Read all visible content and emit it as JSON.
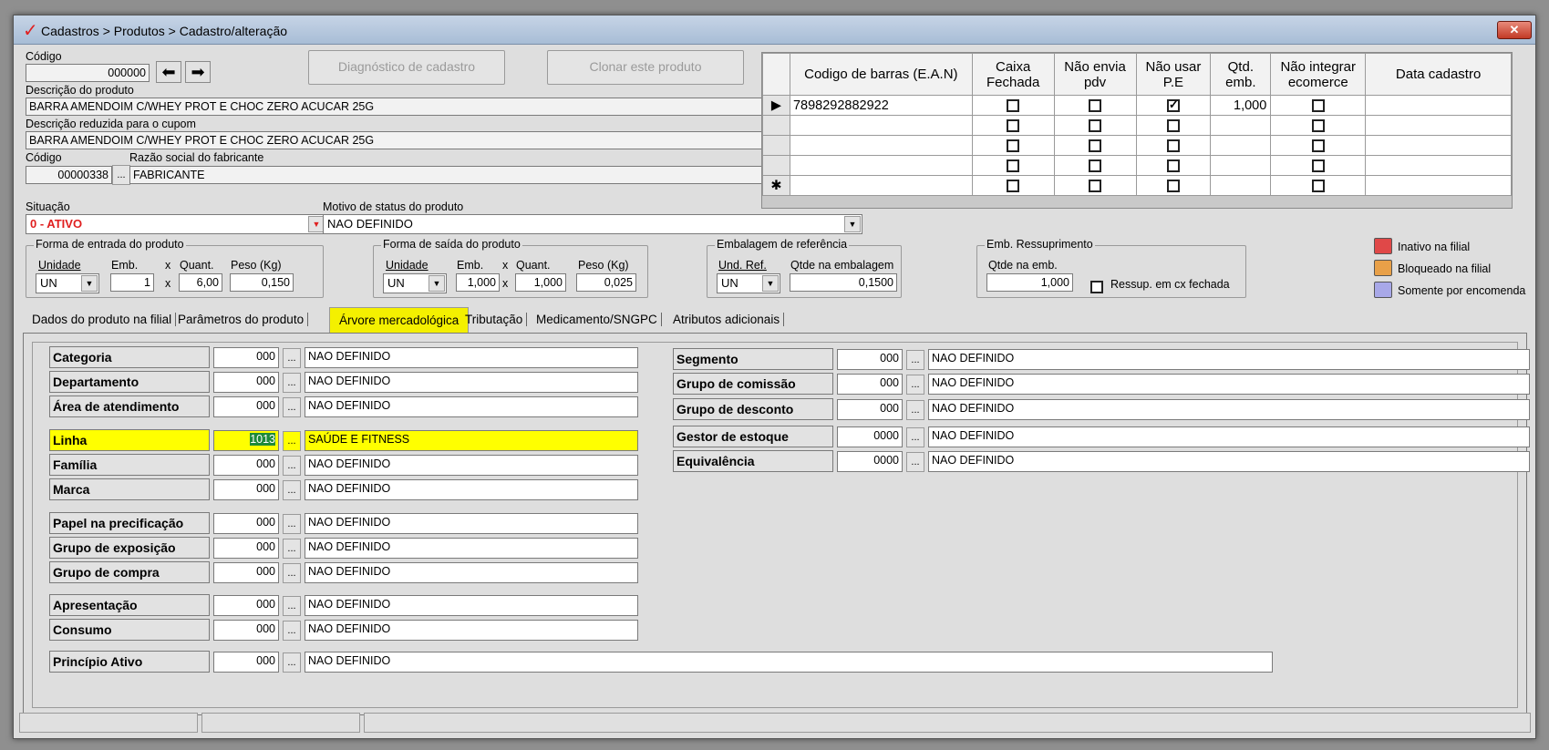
{
  "window": {
    "title": "Cadastros > Produtos > Cadastro/alteração",
    "close_label": "✕"
  },
  "header": {
    "codigo_label": "Código",
    "codigo_value": "000000",
    "diagnostico_label": "Diagnóstico de cadastro",
    "clonar_label": "Clonar este produto",
    "descricao_label": "Descrição  do produto",
    "descricao_value": "BARRA AMENDOIM C/WHEY PROT E CHOC ZERO ACUCAR 25G",
    "descricao_reduzida_label": "Descrição reduzida para o cupom",
    "descricao_reduzida_value": "BARRA AMENDOIM C/WHEY PROT E CHOC ZERO ACUCAR 25G",
    "fabricante_codigo_label": "Código",
    "fabricante_codigo_value": "00000338",
    "fabricante_razao_label": "Razão social do fabricante",
    "fabricante_razao_value": "FABRICANTE",
    "situacao_label": "Situação",
    "situacao_value": "0 - ATIVO",
    "motivo_label": "Motivo de status do produto",
    "motivo_value": "NAO DEFINIDO"
  },
  "barcode_grid": {
    "columns": [
      "Codigo de barras (E.A.N)",
      "Caixa Fechada",
      "Não envia pdv",
      "Não usar P.E",
      "Qtd. emb.",
      "Não integrar ecomerce",
      "Data cadastro"
    ],
    "rows": [
      {
        "marker": "▶",
        "ean": "7898292882922",
        "caixa": false,
        "nao_envia": false,
        "nao_usar": true,
        "qtd": "1,000",
        "nao_integrar": false,
        "data": ""
      },
      {
        "marker": "",
        "ean": "",
        "caixa": false,
        "nao_envia": false,
        "nao_usar": false,
        "qtd": "",
        "nao_integrar": false,
        "data": ""
      },
      {
        "marker": "",
        "ean": "",
        "caixa": false,
        "nao_envia": false,
        "nao_usar": false,
        "qtd": "",
        "nao_integrar": false,
        "data": ""
      },
      {
        "marker": "",
        "ean": "",
        "caixa": false,
        "nao_envia": false,
        "nao_usar": false,
        "qtd": "",
        "nao_integrar": false,
        "data": ""
      },
      {
        "marker": "✱",
        "ean": "",
        "caixa": false,
        "nao_envia": false,
        "nao_usar": false,
        "qtd": "",
        "nao_integrar": false,
        "data": ""
      }
    ]
  },
  "entrada": {
    "title": "Forma de entrada do produto",
    "unidade_label": "Unidade",
    "emb_label": "Emb.",
    "x_label": "x",
    "quant_label": "Quant.",
    "peso_label": "Peso (Kg)",
    "unidade": "UN",
    "emb": "1",
    "quant": "6,00",
    "peso": "0,150"
  },
  "saida": {
    "title": "Forma de saída do produto",
    "unidade_label": "Unidade",
    "emb_label": "Emb.",
    "x_label": "x",
    "quant_label": "Quant.",
    "peso_label": "Peso (Kg)",
    "unidade": "UN",
    "emb": "1,000",
    "quant": "1,000",
    "peso": "0,025"
  },
  "embalagem": {
    "title": "Embalagem de referência",
    "und_label": "Und. Ref.",
    "qtde_label": "Qtde na embalagem",
    "und": "UN",
    "qtde": "0,1500"
  },
  "ressuprimento": {
    "title": "Emb. Ressuprimento",
    "qtde_label": "Qtde na emb.",
    "qtde": "1,000",
    "check_label": "Ressup. em cx fechada"
  },
  "legend": [
    {
      "label": "Inativo na filial",
      "color": "#e04848"
    },
    {
      "label": "Bloqueado na filial",
      "color": "#e8a048"
    },
    {
      "label": "Somente por encomenda",
      "color": "#a8a8e8"
    }
  ],
  "tabs": [
    "Dados do produto na filial",
    "Parâmetros do produto",
    "Árvore mercadológica",
    "Tributação",
    "Medicamento/SNGPC",
    "Atributos adicionais"
  ],
  "left_fields": [
    {
      "label": "Categoria",
      "code": "000",
      "desc": "NAO DEFINIDO"
    },
    {
      "label": "Departamento",
      "code": "000",
      "desc": "NAO DEFINIDO"
    },
    {
      "label": "Área de atendimento",
      "code": "000",
      "desc": "NAO DEFINIDO"
    },
    {
      "label": "Linha",
      "code": "1013",
      "desc": "SAÚDE E FITNESS"
    },
    {
      "label": "Família",
      "code": "000",
      "desc": "NAO DEFINIDO"
    },
    {
      "label": "Marca",
      "code": "000",
      "desc": "NAO DEFINIDO"
    },
    {
      "label": "Papel na precificação",
      "code": "000",
      "desc": "NAO DEFINIDO"
    },
    {
      "label": "Grupo de exposição",
      "code": "000",
      "desc": "NAO DEFINIDO"
    },
    {
      "label": "Grupo de compra",
      "code": "000",
      "desc": "NAO DEFINIDO"
    },
    {
      "label": "Apresentação",
      "code": "000",
      "desc": "NAO DEFINIDO"
    },
    {
      "label": "Consumo",
      "code": "000",
      "desc": "NAO DEFINIDO"
    },
    {
      "label": "Princípio Ativo",
      "code": "000",
      "desc": "NAO DEFINIDO"
    }
  ],
  "right_fields": [
    {
      "label": "Segmento",
      "code": "000",
      "desc": "NAO DEFINIDO"
    },
    {
      "label": "Grupo de comissão",
      "code": "000",
      "desc": "NAO DEFINIDO"
    },
    {
      "label": "Grupo de desconto",
      "code": "000",
      "desc": "NAO DEFINIDO"
    },
    {
      "label": "Gestor de estoque",
      "code": "0000",
      "desc": "NAO DEFINIDO"
    },
    {
      "label": "Equivalência",
      "code": "0000",
      "desc": "NAO DEFINIDO"
    }
  ],
  "dots_label": "...",
  "highlight_color": "#ffff00"
}
